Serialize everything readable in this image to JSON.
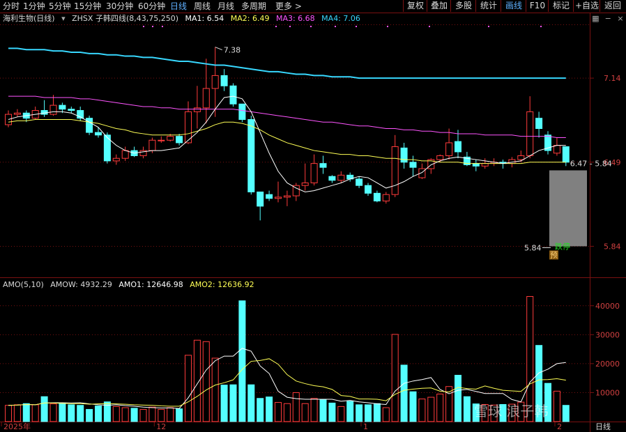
{
  "toolbar": {
    "tabs": [
      {
        "label": "分时"
      },
      {
        "label": "1分钟"
      },
      {
        "label": "5分钟"
      },
      {
        "label": "15分钟"
      },
      {
        "label": "30分钟"
      },
      {
        "label": "60分钟"
      },
      {
        "label": "日线",
        "active": true
      },
      {
        "label": "周线"
      },
      {
        "label": "月线"
      },
      {
        "label": "多周期"
      },
      {
        "label": "更多 >"
      }
    ],
    "right_buttons": [
      {
        "label": "复权"
      },
      {
        "label": "叠加"
      },
      {
        "label": "多股"
      },
      {
        "label": "统计"
      },
      {
        "label": "画线",
        "active": true
      },
      {
        "label": "F10"
      },
      {
        "label": "标记"
      },
      {
        "label": "+自选"
      },
      {
        "label": "返回"
      }
    ]
  },
  "legend": {
    "title": "海利生物(日线)",
    "indicator": "ZHSX 子韩四线(8,43,75,250)",
    "ma1": "MA1: 6.54",
    "ma2": "MA2: 6.49",
    "ma3": "MA3: 6.68",
    "ma4": "MA4: 7.06"
  },
  "amo_legend": {
    "title": "AMO(5,10)",
    "amow": "AMOW: 4932.29",
    "amo1": "AMO1: 12646.98",
    "amo2": "AMO2: 12636.92"
  },
  "price_axis": {
    "labels": [
      "7.14",
      "6.49",
      "5.84"
    ]
  },
  "volume_axis": {
    "labels": [
      "40000",
      "30000",
      "20000",
      "10000"
    ]
  },
  "date_axis": {
    "labels": [
      "2025年",
      "12",
      "1",
      "2"
    ],
    "period": "日线"
  },
  "annotations": {
    "high": "7.38",
    "range": "6.47 - 5.84",
    "low": "5.84",
    "limit_down": "跌停",
    "predict": "预"
  },
  "colors": {
    "up": "#ff3b3b",
    "down": "#54ffff",
    "ma1": "#ffffff",
    "ma2": "#ffff55",
    "ma3": "#ff55ff",
    "ma4": "#38d8ff",
    "grid": "#7a1111"
  },
  "icons": {
    "window_controls": [
      "grid-icon",
      "minus-icon",
      "close-icon"
    ]
  },
  "watermark": "雪球 浪子韩",
  "chart_data": {
    "type": "candlestick",
    "price_ylim": [
      5.6,
      7.55
    ],
    "volume_ylim": [
      0,
      45000
    ],
    "candles": [
      [
        6.78,
        6.86,
        6.76,
        6.89
      ],
      [
        6.86,
        6.87,
        6.84,
        6.9
      ],
      [
        6.87,
        6.83,
        6.8,
        6.89
      ],
      [
        6.83,
        6.89,
        6.82,
        6.92
      ],
      [
        6.89,
        6.86,
        6.84,
        6.97
      ],
      [
        6.86,
        6.93,
        6.85,
        7.01
      ],
      [
        6.93,
        6.9,
        6.87,
        6.95
      ],
      [
        6.9,
        6.89,
        6.87,
        6.92
      ],
      [
        6.89,
        6.83,
        6.81,
        6.92
      ],
      [
        6.83,
        6.72,
        6.7,
        6.85
      ],
      [
        6.72,
        6.7,
        6.68,
        6.76
      ],
      [
        6.7,
        6.5,
        6.48,
        6.72
      ],
      [
        6.5,
        6.52,
        6.47,
        6.55
      ],
      [
        6.52,
        6.58,
        6.5,
        6.61
      ],
      [
        6.58,
        6.54,
        6.53,
        6.61
      ],
      [
        6.54,
        6.58,
        6.52,
        6.61
      ],
      [
        6.58,
        6.66,
        6.56,
        6.68
      ],
      [
        6.66,
        6.66,
        6.64,
        6.69
      ],
      [
        6.66,
        6.69,
        6.65,
        6.71
      ],
      [
        6.69,
        6.64,
        6.62,
        6.71
      ],
      [
        6.64,
        6.88,
        6.63,
        6.96
      ],
      [
        6.88,
        6.91,
        6.75,
        7.08
      ],
      [
        6.91,
        7.06,
        6.79,
        7.29
      ],
      [
        7.06,
        7.16,
        6.84,
        7.38
      ],
      [
        7.16,
        7.08,
        7.04,
        7.21
      ],
      [
        7.08,
        6.94,
        6.92,
        7.1
      ],
      [
        6.94,
        6.82,
        6.8,
        6.91
      ],
      [
        6.82,
        6.26,
        6.24,
        6.85
      ],
      [
        6.26,
        6.15,
        6.04,
        6.26
      ],
      [
        6.24,
        6.21,
        6.19,
        6.27
      ],
      [
        6.21,
        6.22,
        6.18,
        6.34
      ],
      [
        6.22,
        6.23,
        6.15,
        6.27
      ],
      [
        6.23,
        6.31,
        6.19,
        6.33
      ],
      [
        6.31,
        6.33,
        6.27,
        6.48
      ],
      [
        6.33,
        6.48,
        6.31,
        6.55
      ],
      [
        6.48,
        6.45,
        6.4,
        6.54
      ],
      [
        6.38,
        6.35,
        6.33,
        6.39
      ],
      [
        6.35,
        6.39,
        6.33,
        6.42
      ],
      [
        6.39,
        6.36,
        6.34,
        6.41
      ],
      [
        6.36,
        6.31,
        6.29,
        6.38
      ],
      [
        6.31,
        6.25,
        6.23,
        6.33
      ],
      [
        6.25,
        6.19,
        6.18,
        6.27
      ],
      [
        6.19,
        6.24,
        6.17,
        6.26
      ],
      [
        6.24,
        6.61,
        6.22,
        6.7
      ],
      [
        6.6,
        6.49,
        6.44,
        6.64
      ],
      [
        6.49,
        6.45,
        6.38,
        6.54
      ],
      [
        6.37,
        6.44,
        6.36,
        6.48
      ],
      [
        6.44,
        6.51,
        6.4,
        6.52
      ],
      [
        6.51,
        6.54,
        6.49,
        6.55
      ],
      [
        6.54,
        6.64,
        6.51,
        6.75
      ],
      [
        6.65,
        6.57,
        6.52,
        6.74
      ],
      [
        6.53,
        6.47,
        6.46,
        6.57
      ],
      [
        6.48,
        6.46,
        6.42,
        6.51
      ],
      [
        6.46,
        6.48,
        6.44,
        6.52
      ],
      [
        6.48,
        6.49,
        6.46,
        6.52
      ],
      [
        6.49,
        6.48,
        6.44,
        6.51
      ],
      [
        6.48,
        6.51,
        6.45,
        6.53
      ],
      [
        6.51,
        6.54,
        6.49,
        6.58
      ],
      [
        6.54,
        6.88,
        6.52,
        7.0
      ],
      [
        6.83,
        6.75,
        6.68,
        6.88
      ],
      [
        6.7,
        6.58,
        6.55,
        6.73
      ],
      [
        6.56,
        6.62,
        6.54,
        6.68
      ],
      [
        6.61,
        6.49,
        6.46,
        6.61
      ]
    ],
    "ma1": [
      6.82,
      6.84,
      6.85,
      6.86,
      6.87,
      6.88,
      6.88,
      6.87,
      6.84,
      6.8,
      6.76,
      6.68,
      6.62,
      6.58,
      6.56,
      6.57,
      6.58,
      6.58,
      6.59,
      6.6,
      6.66,
      6.72,
      6.8,
      6.9,
      6.99,
      7.0,
      6.98,
      6.88,
      6.72,
      6.56,
      6.42,
      6.33,
      6.29,
      6.26,
      6.27,
      6.29,
      6.31,
      6.33,
      6.36,
      6.38,
      6.37,
      6.33,
      6.29,
      6.31,
      6.34,
      6.38,
      6.41,
      6.47,
      6.5,
      6.52,
      6.53,
      6.52,
      6.51,
      6.5,
      6.49,
      6.48,
      6.49,
      6.5,
      6.54,
      6.58,
      6.6,
      6.62,
      6.62
    ],
    "ma2": [
      6.8,
      6.81,
      6.81,
      6.82,
      6.82,
      6.82,
      6.82,
      6.82,
      6.81,
      6.8,
      6.79,
      6.77,
      6.75,
      6.74,
      6.72,
      6.71,
      6.7,
      6.7,
      6.7,
      6.7,
      6.71,
      6.73,
      6.75,
      6.78,
      6.8,
      6.8,
      6.79,
      6.77,
      6.74,
      6.7,
      6.67,
      6.64,
      6.62,
      6.6,
      6.58,
      6.57,
      6.56,
      6.55,
      6.55,
      6.54,
      6.54,
      6.53,
      6.52,
      6.52,
      6.51,
      6.51,
      6.5,
      6.5,
      6.49,
      6.49,
      6.49,
      6.48,
      6.48,
      6.48,
      6.48,
      6.48,
      6.48,
      6.48,
      6.49,
      6.49,
      6.49,
      6.49,
      6.49
    ],
    "ma3": [
      7.0,
      7.0,
      7.0,
      7.0,
      6.99,
      6.99,
      6.99,
      6.99,
      6.98,
      6.98,
      6.97,
      6.96,
      6.95,
      6.94,
      6.93,
      6.92,
      6.92,
      6.91,
      6.91,
      6.9,
      6.9,
      6.9,
      6.9,
      6.9,
      6.9,
      6.9,
      6.89,
      6.88,
      6.87,
      6.86,
      6.85,
      6.84,
      6.83,
      6.82,
      6.81,
      6.8,
      6.8,
      6.79,
      6.78,
      6.77,
      6.77,
      6.76,
      6.75,
      6.75,
      6.74,
      6.74,
      6.73,
      6.73,
      6.72,
      6.72,
      6.71,
      6.71,
      6.71,
      6.7,
      6.7,
      6.7,
      6.7,
      6.69,
      6.69,
      6.69,
      6.69,
      6.68,
      6.68
    ],
    "ma4": [
      7.37,
      7.37,
      7.36,
      7.36,
      7.36,
      7.35,
      7.35,
      7.34,
      7.34,
      7.33,
      7.33,
      7.32,
      7.32,
      7.31,
      7.31,
      7.3,
      7.3,
      7.29,
      7.28,
      7.27,
      7.27,
      7.26,
      7.25,
      7.24,
      7.24,
      7.23,
      7.22,
      7.21,
      7.2,
      7.19,
      7.19,
      7.18,
      7.17,
      7.17,
      7.16,
      7.16,
      7.15,
      7.15,
      7.15,
      7.14,
      7.14,
      7.14,
      7.14,
      7.14,
      7.14,
      7.14,
      7.14,
      7.14,
      7.14,
      7.14,
      7.14,
      7.14,
      7.14,
      7.14,
      7.14,
      7.14,
      7.14,
      7.14,
      7.14,
      7.14,
      7.14,
      7.14,
      7.14
    ],
    "amo": [
      5600,
      5800,
      6200,
      5800,
      8600,
      6100,
      6200,
      5800,
      5600,
      4200,
      5400,
      6800,
      5200,
      4800,
      4600,
      4200,
      5000,
      4200,
      4800,
      4400,
      22900,
      28100,
      27600,
      21900,
      12600,
      12700,
      41700,
      12700,
      8000,
      8500,
      6600,
      6200,
      10000,
      6200,
      8000,
      7500,
      6400,
      5200,
      7000,
      5800,
      5800,
      6200,
      4800,
      30100,
      19500,
      10300,
      7800,
      8400,
      9500,
      12100,
      16000,
      8600,
      6100,
      5900,
      5700,
      5900,
      6000,
      6700,
      43200,
      26300,
      13200,
      10500,
      5600
    ],
    "amo_ma5": [
      5600,
      5700,
      5900,
      5800,
      6400,
      6500,
      6500,
      6400,
      6500,
      6100,
      5800,
      5600,
      5800,
      5500,
      5300,
      5000,
      4800,
      4700,
      4700,
      4500,
      8200,
      13000,
      17800,
      21000,
      22600,
      22600,
      25300,
      24300,
      19200,
      16600,
      10500,
      8400,
      7900,
      7700,
      7700,
      7700,
      7700,
      7000,
      7300,
      6800,
      6500,
      6100,
      5900,
      10500,
      13200,
      14000,
      14500,
      15200,
      11100,
      9600,
      10800,
      11100,
      10400,
      9700,
      9700,
      9700,
      7600,
      6800,
      13600,
      16800,
      18100,
      20000,
      20400
    ],
    "amo_ma10": [
      5600,
      5700,
      5900,
      5800,
      6400,
      6400,
      6300,
      6200,
      6200,
      6000,
      6100,
      6200,
      6100,
      6000,
      5800,
      5700,
      5600,
      5400,
      5300,
      5300,
      6800,
      8700,
      10900,
      12600,
      13400,
      14400,
      18000,
      20800,
      21100,
      21700,
      19800,
      16200,
      14000,
      13100,
      12400,
      12000,
      11100,
      9000,
      8700,
      7800,
      7800,
      7700,
      7200,
      9400,
      10800,
      11200,
      11500,
      11600,
      10500,
      10200,
      11800,
      11400,
      11200,
      12300,
      11500,
      10800,
      10600,
      10400,
      13000,
      14400,
      14500,
      14800,
      14300
    ]
  }
}
